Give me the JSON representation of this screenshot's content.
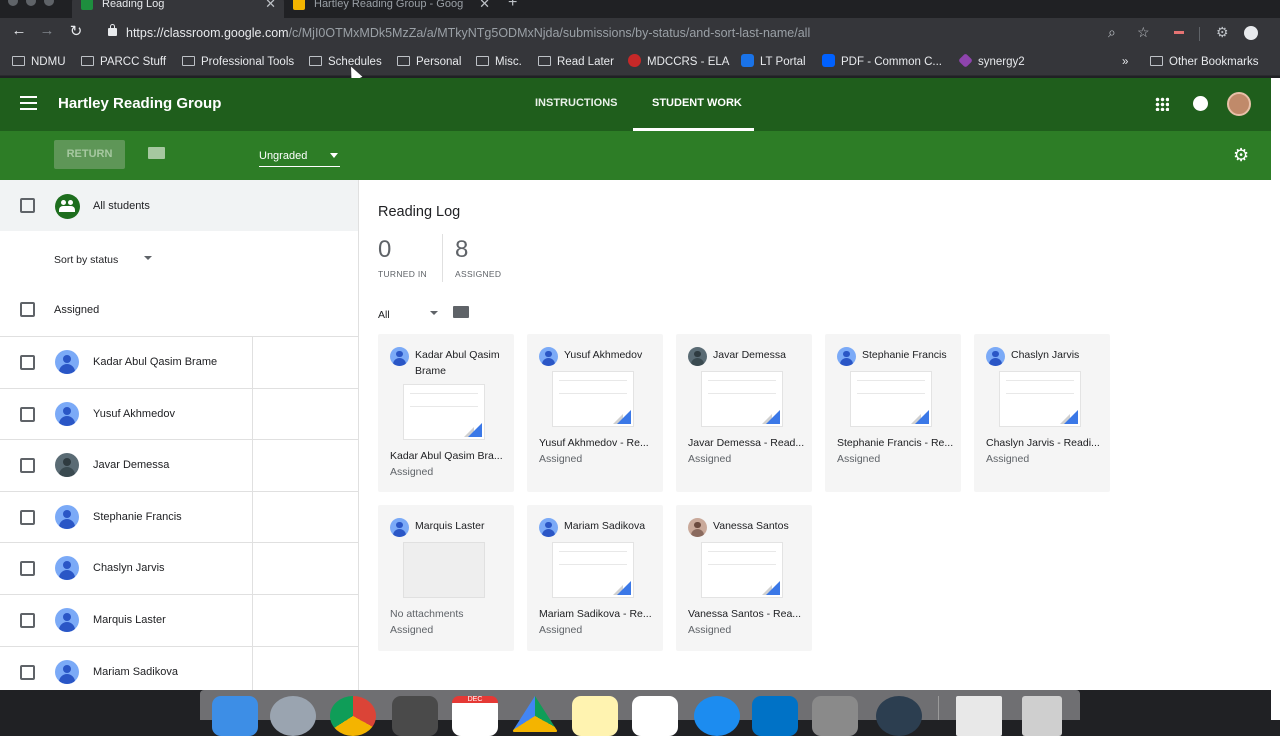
{
  "browser": {
    "tabs": [
      {
        "title": "Reading Log",
        "active": true
      },
      {
        "title": "Hartley Reading Group - Goog",
        "active": false
      }
    ],
    "url_host": "https://classroom.google.com",
    "url_path": "/c/MjI0OTMxMDk5MzZa/a/MTkyNTg5ODMxNjda/submissions/by-status/and-sort-last-name/all",
    "bookmarks": [
      {
        "label": "NDMU",
        "type": "folder"
      },
      {
        "label": "PARCC Stuff",
        "type": "folder"
      },
      {
        "label": "Professional Tools",
        "type": "folder"
      },
      {
        "label": "Schedules",
        "type": "folder"
      },
      {
        "label": "Personal",
        "type": "folder"
      },
      {
        "label": "Misc.",
        "type": "folder"
      },
      {
        "label": "Read Later",
        "type": "folder"
      },
      {
        "label": "MDCCRS - ELA",
        "type": "site"
      },
      {
        "label": "LT Portal",
        "type": "site"
      },
      {
        "label": "PDF - Common C...",
        "type": "site"
      },
      {
        "label": "synergy2",
        "type": "site"
      }
    ],
    "more_bookmarks": "»",
    "other_bookmarks": "Other Bookmarks"
  },
  "app": {
    "class_title": "Hartley Reading Group",
    "tabs": [
      {
        "label": "INSTRUCTIONS",
        "active": false
      },
      {
        "label": "STUDENT WORK",
        "active": true
      }
    ],
    "return_label": "RETURN",
    "grade_filter": "Ungraded",
    "colors": {
      "appbar": "#1f5e1c",
      "subbar": "#2d7d26",
      "accent": "#3b78e7"
    }
  },
  "sidebar": {
    "all_students": "All students",
    "sort_label": "Sort by status",
    "group_label": "Assigned",
    "students": [
      {
        "name": "Kadar Abul Qasim Brame",
        "avatar": "default"
      },
      {
        "name": "Yusuf Akhmedov",
        "avatar": "default"
      },
      {
        "name": "Javar Demessa",
        "avatar": "photo"
      },
      {
        "name": "Stephanie Francis",
        "avatar": "default"
      },
      {
        "name": "Chaslyn Jarvis",
        "avatar": "default"
      },
      {
        "name": "Marquis Laster",
        "avatar": "default"
      },
      {
        "name": "Mariam Sadikova",
        "avatar": "default"
      }
    ]
  },
  "main": {
    "assignment_title": "Reading Log",
    "turned_in_count": "0",
    "turned_in_label": "TURNED IN",
    "assigned_count": "8",
    "assigned_label": "ASSIGNED",
    "filter_label": "All",
    "cards": [
      {
        "name": "Kadar Abul Qasim Brame",
        "file": "Kadar Abul Qasim Bra...",
        "status": "Assigned",
        "avatar": "default",
        "attachment": true
      },
      {
        "name": "Yusuf Akhmedov",
        "file": "Yusuf Akhmedov - Re...",
        "status": "Assigned",
        "avatar": "default",
        "attachment": true
      },
      {
        "name": "Javar Demessa",
        "file": "Javar Demessa - Read...",
        "status": "Assigned",
        "avatar": "photo",
        "attachment": true
      },
      {
        "name": "Stephanie Francis",
        "file": "Stephanie Francis - Re...",
        "status": "Assigned",
        "avatar": "default",
        "attachment": true
      },
      {
        "name": "Chaslyn Jarvis",
        "file": "Chaslyn Jarvis - Readi...",
        "status": "Assigned",
        "avatar": "default",
        "attachment": true
      },
      {
        "name": "Marquis Laster",
        "file": "No attachments",
        "status": "Assigned",
        "avatar": "default",
        "attachment": false
      },
      {
        "name": "Mariam Sadikova",
        "file": "Mariam Sadikova - Re...",
        "status": "Assigned",
        "avatar": "default",
        "attachment": true
      },
      {
        "name": "Vanessa Santos",
        "file": "Vanessa Santos - Rea...",
        "status": "Assigned",
        "avatar": "photo2",
        "attachment": true
      }
    ]
  },
  "dock": {
    "calendar_month": "DEC"
  }
}
